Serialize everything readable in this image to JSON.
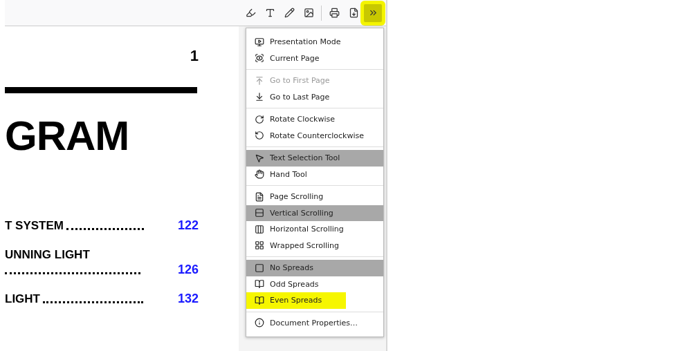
{
  "toolbar": {
    "buttons": [
      {
        "marked": false
      },
      {
        "marked": false
      },
      {
        "marked": false
      },
      {
        "marked": false
      },
      {
        "marked": false
      },
      {
        "marked": false
      },
      {
        "marked": true
      }
    ]
  },
  "document": {
    "page_number": "1",
    "heading": "GRAM",
    "toc": [
      {
        "text": "T SYSTEM",
        "wrapped": false,
        "page": "122"
      },
      {
        "text": "UNNING LIGHT",
        "wrapped": true,
        "page": "126"
      },
      {
        "text": "LIGHT",
        "wrapped": false,
        "page": "132"
      }
    ]
  },
  "menu": {
    "groups": [
      {
        "items": [
          {
            "label": "Presentation Mode",
            "selected": false,
            "disabled": false,
            "marked": false
          },
          {
            "label": "Current Page",
            "selected": false,
            "disabled": false,
            "marked": false
          }
        ]
      },
      {
        "items": [
          {
            "label": "Go to First Page",
            "selected": false,
            "disabled": true,
            "marked": false
          },
          {
            "label": "Go to Last Page",
            "selected": false,
            "disabled": false,
            "marked": false
          }
        ]
      },
      {
        "items": [
          {
            "label": "Rotate Clockwise",
            "selected": false,
            "disabled": false,
            "marked": false
          },
          {
            "label": "Rotate Counterclockwise",
            "selected": false,
            "disabled": false,
            "marked": false
          }
        ]
      },
      {
        "items": [
          {
            "label": "Text Selection Tool",
            "selected": true,
            "disabled": false,
            "marked": false
          },
          {
            "label": "Hand Tool",
            "selected": false,
            "disabled": false,
            "marked": false
          }
        ]
      },
      {
        "items": [
          {
            "label": "Page Scrolling",
            "selected": false,
            "disabled": false,
            "marked": false
          },
          {
            "label": "Vertical Scrolling",
            "selected": true,
            "disabled": false,
            "marked": false
          },
          {
            "label": "Horizontal Scrolling",
            "selected": false,
            "disabled": false,
            "marked": false
          },
          {
            "label": "Wrapped Scrolling",
            "selected": false,
            "disabled": false,
            "marked": false
          }
        ]
      },
      {
        "items": [
          {
            "label": "No Spreads",
            "selected": true,
            "disabled": false,
            "marked": false
          },
          {
            "label": "Odd Spreads",
            "selected": false,
            "disabled": false,
            "marked": false
          },
          {
            "label": "Even Spreads",
            "selected": false,
            "disabled": false,
            "marked": true
          }
        ]
      },
      {
        "items": [
          {
            "label": "Document Properties…",
            "selected": false,
            "disabled": false,
            "marked": false
          }
        ]
      }
    ]
  }
}
